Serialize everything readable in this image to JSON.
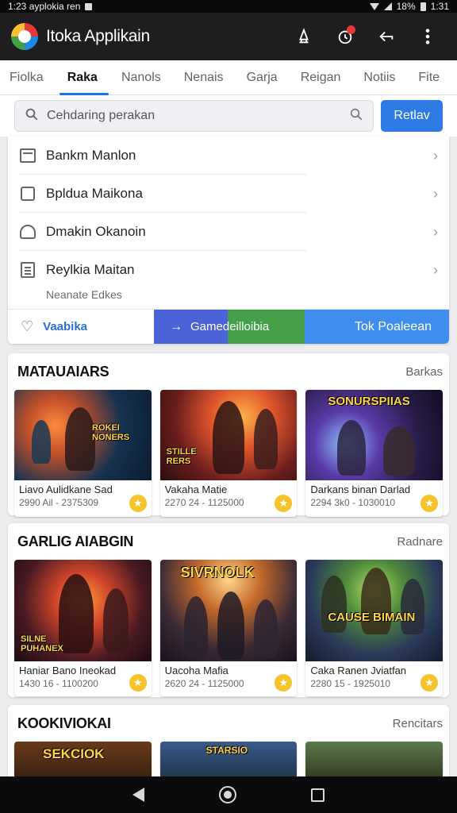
{
  "status_bar": {
    "time_text": "1:23 ayplokia ren",
    "battery_text": "18%",
    "clock_right": "1:31"
  },
  "app_bar": {
    "title": "Itoka Applikain",
    "icons": [
      "rocket-icon",
      "notification-icon",
      "share-icon",
      "more-vert-icon"
    ],
    "accent": "#1e1e20"
  },
  "tabs": [
    {
      "label": "Fiolka",
      "active": false
    },
    {
      "label": "Raka",
      "active": true
    },
    {
      "label": "Nanols",
      "active": false
    },
    {
      "label": "Nenais",
      "active": false
    },
    {
      "label": "Garja",
      "active": false
    },
    {
      "label": "Reigan",
      "active": false
    },
    {
      "label": "Notiis",
      "active": false
    },
    {
      "label": "Fite",
      "active": false
    }
  ],
  "search": {
    "placeholder": "Cehdaring perakan",
    "button_label": "Retlav",
    "button_color": "#2f7be6"
  },
  "menu": {
    "items": [
      {
        "icon": "calendar-icon",
        "label": "Bankm Manlon"
      },
      {
        "icon": "square-icon",
        "label": "Bpldua Maikona"
      },
      {
        "icon": "user-icon",
        "label": "Dmakin Okanoin"
      },
      {
        "icon": "document-icon",
        "label": "Reylkia Maitan"
      }
    ],
    "subtext": "Neanate Edkes",
    "actions": {
      "first": "Vaabika",
      "second_left": "Game",
      "second_right": "deilloibia",
      "third": "Tok Poaleean"
    }
  },
  "sections": [
    {
      "title": "MATAUAIARS",
      "more": "Barkas",
      "cards": [
        {
          "name": "Liavo Aulidkane Sad",
          "meta": "2990 Ail - 2375309",
          "art": "ROKEI NONERS"
        },
        {
          "name": "Vakaha Matie",
          "meta": "2270 24 - 1125000",
          "art": "STILLE RERS"
        },
        {
          "name": "Darkans binan Darlad",
          "meta": "2294 3k0 - 1030010",
          "art": "SONURSPIIAS"
        }
      ]
    },
    {
      "title": "GARLIG AIABGIN",
      "more": "Radnare",
      "cards": [
        {
          "name": "Haniar Bano Ineokad",
          "meta": "1430 16 - 1100200",
          "art": "SILNE PUHANEX"
        },
        {
          "name": "Uacoha Mafia",
          "meta": "2620 24 - 1125000",
          "art": "SIVRNOLK"
        },
        {
          "name": "Caka Ranen Jviatfan",
          "meta": "2280 15 - 1925010",
          "art": "CAUSE BIMAIN"
        }
      ]
    },
    {
      "title": "KOOKIVIOKAI",
      "more": "Rencitars",
      "cards": [
        {
          "art": "SEKCIOK"
        },
        {
          "art": "STARSIO"
        },
        {
          "art": ""
        }
      ]
    }
  ]
}
